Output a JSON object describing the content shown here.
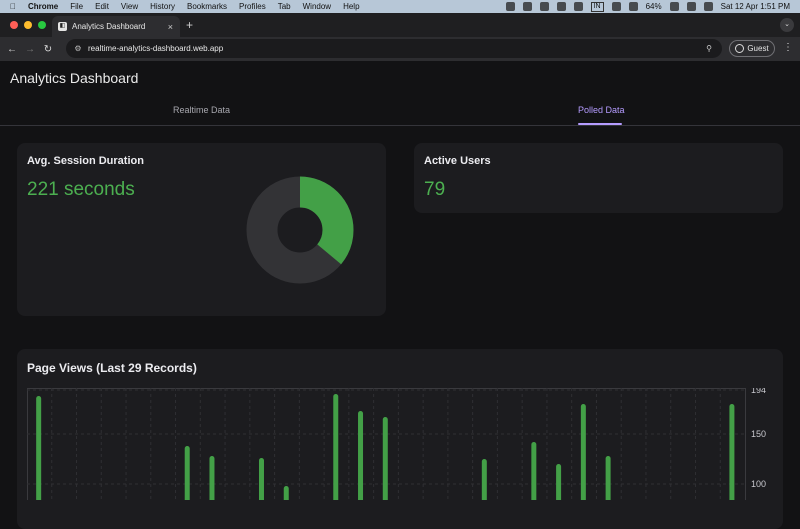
{
  "menubar": {
    "apple": "",
    "items": [
      "Chrome",
      "File",
      "Edit",
      "View",
      "History",
      "Bookmarks",
      "Profiles",
      "Tab",
      "Window",
      "Help"
    ],
    "input_source": "IN",
    "battery": "64%",
    "datetime": "Sat 12 Apr  1:51 PM"
  },
  "browser": {
    "tab_title": "Analytics Dashboard",
    "close": "×",
    "new_tab": "+",
    "url": "realtime-analytics-dashboard.web.app",
    "profile": "Guest"
  },
  "page": {
    "title": "Analytics Dashboard",
    "tabs": [
      {
        "label": "Realtime Data",
        "active": false
      },
      {
        "label": "Polled Data",
        "active": true
      }
    ]
  },
  "session_card": {
    "title": "Avg. Session Duration",
    "value": "221 seconds",
    "donut_fraction": 0.36,
    "accent": "#43a047",
    "track": "#333336"
  },
  "users_card": {
    "title": "Active Users",
    "value": "79"
  },
  "pageviews_card": {
    "title": "Page Views (Last 29 Records)"
  },
  "chart_data": {
    "type": "bar",
    "title": "Page Views (Last 29 Records)",
    "ylim": [
      0,
      194
    ],
    "yticks": [
      100,
      150,
      194
    ],
    "color": "#43a047",
    "values": [
      188,
      5,
      0,
      5,
      10,
      12,
      138,
      128,
      0,
      126,
      98,
      8,
      190,
      173,
      167,
      0,
      0,
      0,
      125,
      0,
      142,
      120,
      180,
      128,
      9,
      0,
      0,
      0,
      180
    ],
    "grid": true,
    "yaxis_position": "right"
  }
}
